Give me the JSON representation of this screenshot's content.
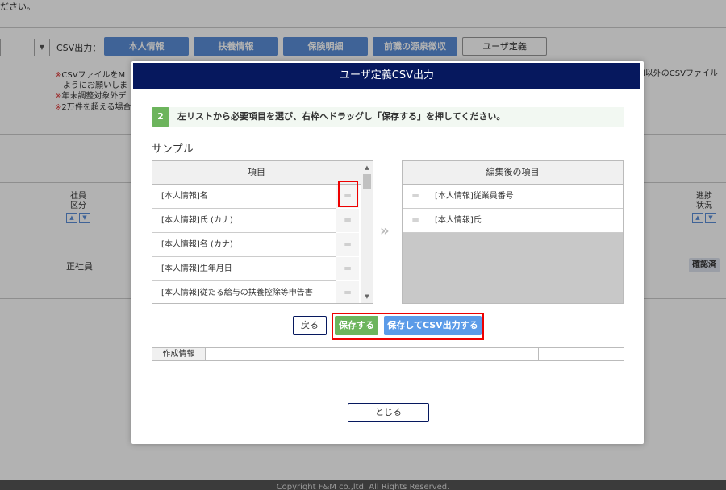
{
  "background": {
    "top_text": "ださい。",
    "csv_label": "CSV出力：",
    "csv_buttons": [
      "本人情報",
      "扶養情報",
      "保険明細",
      "前職の源泉徴収",
      "ユーザ定義"
    ],
    "notes": [
      {
        "mark": "※",
        "text": "CSVファイルをM"
      },
      {
        "mark": "",
        "text": "ようにお願いしま"
      },
      {
        "mark": "※",
        "text": "年末調整対象外デ"
      },
      {
        "mark": "※",
        "text": "2万件を超える場合"
      }
    ],
    "note_right": "l以外のCSVファイル",
    "table_headers": {
      "employee_type": [
        "社員",
        "区分"
      ],
      "progress": [
        "進捗",
        "状況"
      ],
      "sort_up": "▲",
      "sort_down": "▼"
    },
    "row_employee_type": "正社員",
    "row_status_badge": "確認済",
    "footer": "Copyright F&M co.,ltd. All Rights Reserved."
  },
  "modal": {
    "title": "ユーザ定義CSV出力",
    "step_number": "2",
    "step_text": "左リストから必要項目を選び、右枠へドラッグし「保存する」を押してください。",
    "sample_title": "サンプル",
    "left_list": {
      "header": "項目",
      "items": [
        "[本人情報]名",
        "[本人情報]氏 (カナ)",
        "[本人情報]名 (カナ)",
        "[本人情報]生年月日",
        "[本人情報]従たる給与の扶養控除等申告書"
      ]
    },
    "move_arrow": "»",
    "right_list": {
      "header": "編集後の項目",
      "items": [
        "[本人情報]従業員番号",
        "[本人情報]氏"
      ]
    },
    "handle_glyph": "═",
    "buttons": {
      "back": "戻る",
      "save": "保存する",
      "save_csv": "保存してCSV出力する"
    },
    "info_label": "作成情報",
    "close": "とじる"
  }
}
